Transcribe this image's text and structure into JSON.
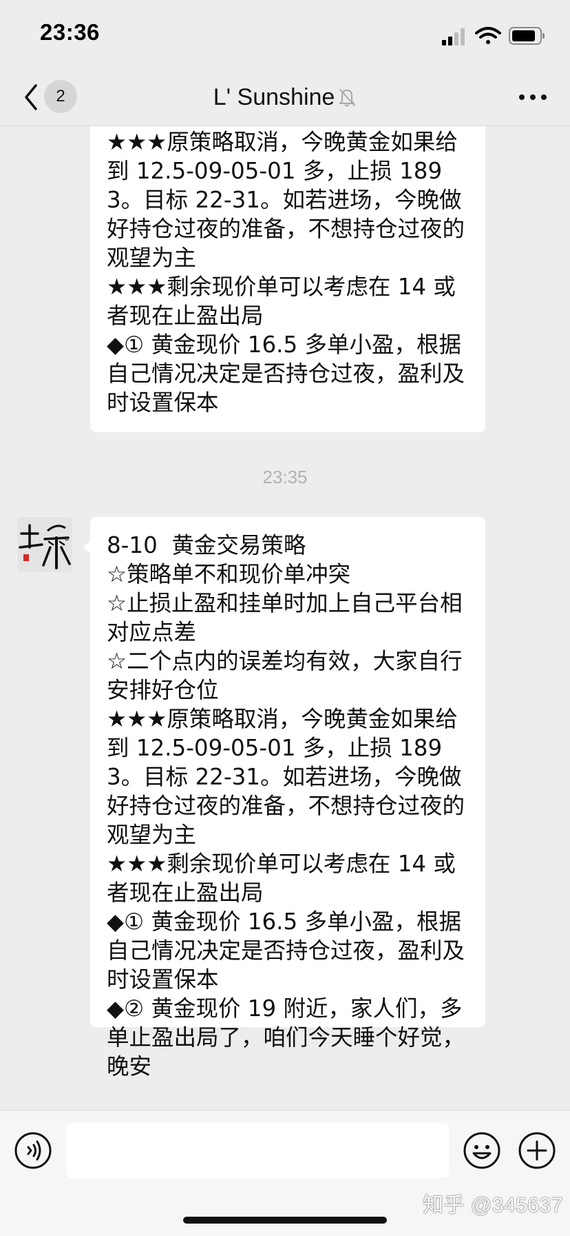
{
  "status_bar": {
    "time": "23:36"
  },
  "nav": {
    "unread_count": "2",
    "title": "L' Sunshine"
  },
  "messages": [
    {
      "text": "★★★原策略取消，今晚黄金如果给到 12.5-09-05-01 多，止损 1893。目标 22-31。如若进场，今晚做好持仓过夜的准备，不想持仓过夜的观望为主\n★★★剩余现价单可以考虑在 14 或者现在止盈出局\n◆① 黄金现价 16.5 多单小盈，根据自己情况决定是否持仓过夜，盈利及时设置保本"
    },
    {
      "text": "8-10  黄金交易策略\n☆策略单不和现价单冲突\n☆止损止盈和挂单时加上自己平台相对应点差\n☆二个点内的误差均有效，大家自行安排好仓位\n★★★原策略取消，今晚黄金如果给到 12.5-09-05-01 多，止损 1893。目标 22-31。如若进场，今晚做好持仓过夜的准备，不想持仓过夜的观望为主\n★★★剩余现价单可以考虑在 14 或者现在止盈出局\n◆① 黄金现价 16.5 多单小盈，根据自己情况决定是否持仓过夜，盈利及时设置保本\n◆② 黄金现价 19 附近，家人们，多单止盈出局了，咱们今天睡个好觉，晚安"
    }
  ],
  "time_divider": "23:35",
  "input": {
    "value": "",
    "placeholder": ""
  },
  "watermark": "知乎 @345637",
  "icons": {
    "back": "chevron-left-icon",
    "mute": "bell-slash-icon",
    "more": "more-dots-icon",
    "voice": "voice-icon",
    "emoji": "emoji-icon",
    "plus": "plus-icon"
  },
  "colors": {
    "background": "#ededed",
    "bubble": "#ffffff",
    "timestamp": "#b2b2b2"
  }
}
